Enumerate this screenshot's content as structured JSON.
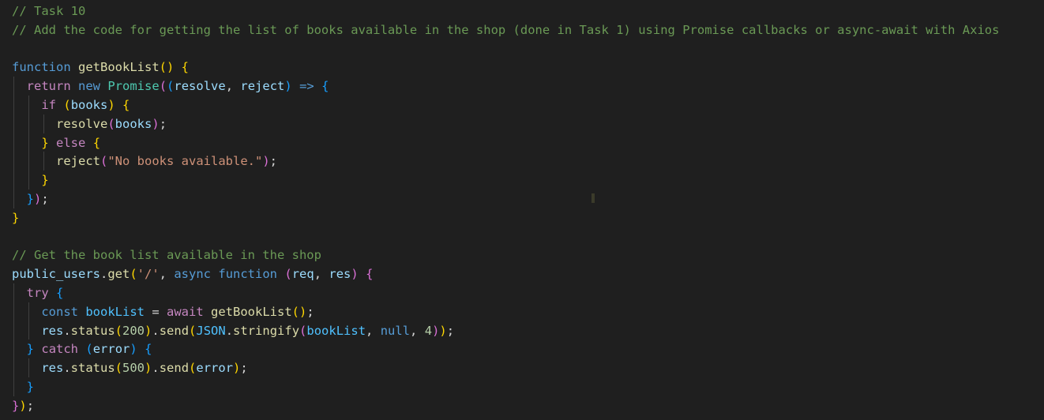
{
  "editor": {
    "colors": {
      "background": "#1f1f1f",
      "comment": "#6a9955",
      "keyword_blue": "#569cd6",
      "keyword_control": "#c586c0",
      "function": "#dcdcaa",
      "variable": "#9cdcfe",
      "constant": "#4fc1ff",
      "class": "#4ec9b0",
      "string": "#ce9178",
      "number": "#b5cea8",
      "plain": "#d4d4d4",
      "bracket_gold": "#ffd700",
      "bracket_pink": "#da70d6",
      "bracket_blue": "#179fff",
      "indent_guide": "#404040"
    },
    "lines": [
      {
        "tokens": [
          {
            "t": "// Task 10",
            "c": "comment"
          }
        ]
      },
      {
        "tokens": [
          {
            "t": "// Add the code for getting the list of books available in the shop (done in Task 1) using Promise callbacks or async-await with Axios",
            "c": "comment"
          }
        ]
      },
      {
        "tokens": []
      },
      {
        "tokens": [
          {
            "t": "function",
            "c": "keyword_blue"
          },
          {
            "t": " ",
            "c": "plain"
          },
          {
            "t": "getBookList",
            "c": "function"
          },
          {
            "t": "()",
            "c": "bracket_gold"
          },
          {
            "t": " ",
            "c": "plain"
          },
          {
            "t": "{",
            "c": "bracket_gold"
          }
        ]
      },
      {
        "tokens": [
          {
            "t": "  ",
            "c": "plain"
          },
          {
            "t": "return",
            "c": "keyword_control"
          },
          {
            "t": " ",
            "c": "plain"
          },
          {
            "t": "new",
            "c": "keyword_blue"
          },
          {
            "t": " ",
            "c": "plain"
          },
          {
            "t": "Promise",
            "c": "class"
          },
          {
            "t": "(",
            "c": "bracket_pink"
          },
          {
            "t": "(",
            "c": "bracket_blue"
          },
          {
            "t": "resolve",
            "c": "variable"
          },
          {
            "t": ", ",
            "c": "plain"
          },
          {
            "t": "reject",
            "c": "variable"
          },
          {
            "t": ")",
            "c": "bracket_blue"
          },
          {
            "t": " ",
            "c": "plain"
          },
          {
            "t": "=>",
            "c": "keyword_blue"
          },
          {
            "t": " ",
            "c": "plain"
          },
          {
            "t": "{",
            "c": "bracket_blue"
          }
        ]
      },
      {
        "tokens": [
          {
            "t": "    ",
            "c": "plain"
          },
          {
            "t": "if",
            "c": "keyword_control"
          },
          {
            "t": " ",
            "c": "plain"
          },
          {
            "t": "(",
            "c": "bracket_gold"
          },
          {
            "t": "books",
            "c": "variable"
          },
          {
            "t": ")",
            "c": "bracket_gold"
          },
          {
            "t": " ",
            "c": "plain"
          },
          {
            "t": "{",
            "c": "bracket_gold"
          }
        ]
      },
      {
        "tokens": [
          {
            "t": "      ",
            "c": "plain"
          },
          {
            "t": "resolve",
            "c": "function"
          },
          {
            "t": "(",
            "c": "bracket_pink"
          },
          {
            "t": "books",
            "c": "variable"
          },
          {
            "t": ")",
            "c": "bracket_pink"
          },
          {
            "t": ";",
            "c": "plain"
          }
        ]
      },
      {
        "tokens": [
          {
            "t": "    ",
            "c": "plain"
          },
          {
            "t": "}",
            "c": "bracket_gold"
          },
          {
            "t": " ",
            "c": "plain"
          },
          {
            "t": "else",
            "c": "keyword_control"
          },
          {
            "t": " ",
            "c": "plain"
          },
          {
            "t": "{",
            "c": "bracket_gold"
          }
        ]
      },
      {
        "tokens": [
          {
            "t": "      ",
            "c": "plain"
          },
          {
            "t": "reject",
            "c": "function"
          },
          {
            "t": "(",
            "c": "bracket_pink"
          },
          {
            "t": "\"No books available.\"",
            "c": "string"
          },
          {
            "t": ")",
            "c": "bracket_pink"
          },
          {
            "t": ";",
            "c": "plain"
          }
        ]
      },
      {
        "tokens": [
          {
            "t": "    ",
            "c": "plain"
          },
          {
            "t": "}",
            "c": "bracket_gold"
          }
        ]
      },
      {
        "tokens": [
          {
            "t": "  ",
            "c": "plain"
          },
          {
            "t": "}",
            "c": "bracket_blue"
          },
          {
            "t": ")",
            "c": "bracket_pink"
          },
          {
            "t": ";",
            "c": "plain"
          }
        ]
      },
      {
        "tokens": [
          {
            "t": "}",
            "c": "bracket_gold"
          }
        ]
      },
      {
        "tokens": []
      },
      {
        "tokens": [
          {
            "t": "// Get the book list available in the shop",
            "c": "comment"
          }
        ]
      },
      {
        "tokens": [
          {
            "t": "public_users",
            "c": "variable"
          },
          {
            "t": ".",
            "c": "plain"
          },
          {
            "t": "get",
            "c": "function"
          },
          {
            "t": "(",
            "c": "bracket_gold"
          },
          {
            "t": "'/'",
            "c": "string"
          },
          {
            "t": ", ",
            "c": "plain"
          },
          {
            "t": "async",
            "c": "keyword_blue"
          },
          {
            "t": " ",
            "c": "plain"
          },
          {
            "t": "function",
            "c": "keyword_blue"
          },
          {
            "t": " ",
            "c": "plain"
          },
          {
            "t": "(",
            "c": "bracket_pink"
          },
          {
            "t": "req",
            "c": "variable"
          },
          {
            "t": ", ",
            "c": "plain"
          },
          {
            "t": "res",
            "c": "variable"
          },
          {
            "t": ")",
            "c": "bracket_pink"
          },
          {
            "t": " ",
            "c": "plain"
          },
          {
            "t": "{",
            "c": "bracket_pink"
          }
        ]
      },
      {
        "tokens": [
          {
            "t": "  ",
            "c": "plain"
          },
          {
            "t": "try",
            "c": "keyword_control"
          },
          {
            "t": " ",
            "c": "plain"
          },
          {
            "t": "{",
            "c": "bracket_blue"
          }
        ]
      },
      {
        "tokens": [
          {
            "t": "    ",
            "c": "plain"
          },
          {
            "t": "const",
            "c": "keyword_blue"
          },
          {
            "t": " ",
            "c": "plain"
          },
          {
            "t": "bookList",
            "c": "constant"
          },
          {
            "t": " = ",
            "c": "plain"
          },
          {
            "t": "await",
            "c": "keyword_control"
          },
          {
            "t": " ",
            "c": "plain"
          },
          {
            "t": "getBookList",
            "c": "function"
          },
          {
            "t": "()",
            "c": "bracket_gold"
          },
          {
            "t": ";",
            "c": "plain"
          }
        ]
      },
      {
        "tokens": [
          {
            "t": "    ",
            "c": "plain"
          },
          {
            "t": "res",
            "c": "variable"
          },
          {
            "t": ".",
            "c": "plain"
          },
          {
            "t": "status",
            "c": "function"
          },
          {
            "t": "(",
            "c": "bracket_gold"
          },
          {
            "t": "200",
            "c": "number"
          },
          {
            "t": ")",
            "c": "bracket_gold"
          },
          {
            "t": ".",
            "c": "plain"
          },
          {
            "t": "send",
            "c": "function"
          },
          {
            "t": "(",
            "c": "bracket_gold"
          },
          {
            "t": "JSON",
            "c": "constant"
          },
          {
            "t": ".",
            "c": "plain"
          },
          {
            "t": "stringify",
            "c": "function"
          },
          {
            "t": "(",
            "c": "bracket_pink"
          },
          {
            "t": "bookList",
            "c": "constant"
          },
          {
            "t": ", ",
            "c": "plain"
          },
          {
            "t": "null",
            "c": "keyword_blue"
          },
          {
            "t": ", ",
            "c": "plain"
          },
          {
            "t": "4",
            "c": "number"
          },
          {
            "t": ")",
            "c": "bracket_pink"
          },
          {
            "t": ")",
            "c": "bracket_gold"
          },
          {
            "t": ";",
            "c": "plain"
          }
        ]
      },
      {
        "tokens": [
          {
            "t": "  ",
            "c": "plain"
          },
          {
            "t": "}",
            "c": "bracket_blue"
          },
          {
            "t": " ",
            "c": "plain"
          },
          {
            "t": "catch",
            "c": "keyword_control"
          },
          {
            "t": " ",
            "c": "plain"
          },
          {
            "t": "(",
            "c": "bracket_blue"
          },
          {
            "t": "error",
            "c": "variable"
          },
          {
            "t": ")",
            "c": "bracket_blue"
          },
          {
            "t": " ",
            "c": "plain"
          },
          {
            "t": "{",
            "c": "bracket_blue"
          }
        ]
      },
      {
        "tokens": [
          {
            "t": "    ",
            "c": "plain"
          },
          {
            "t": "res",
            "c": "variable"
          },
          {
            "t": ".",
            "c": "plain"
          },
          {
            "t": "status",
            "c": "function"
          },
          {
            "t": "(",
            "c": "bracket_gold"
          },
          {
            "t": "500",
            "c": "number"
          },
          {
            "t": ")",
            "c": "bracket_gold"
          },
          {
            "t": ".",
            "c": "plain"
          },
          {
            "t": "send",
            "c": "function"
          },
          {
            "t": "(",
            "c": "bracket_gold"
          },
          {
            "t": "error",
            "c": "variable"
          },
          {
            "t": ")",
            "c": "bracket_gold"
          },
          {
            "t": ";",
            "c": "plain"
          }
        ]
      },
      {
        "tokens": [
          {
            "t": "  ",
            "c": "plain"
          },
          {
            "t": "}",
            "c": "bracket_blue"
          }
        ]
      },
      {
        "tokens": [
          {
            "t": "}",
            "c": "bracket_pink"
          },
          {
            "t": ")",
            "c": "bracket_gold"
          },
          {
            "t": ";",
            "c": "plain"
          }
        ]
      }
    ]
  }
}
